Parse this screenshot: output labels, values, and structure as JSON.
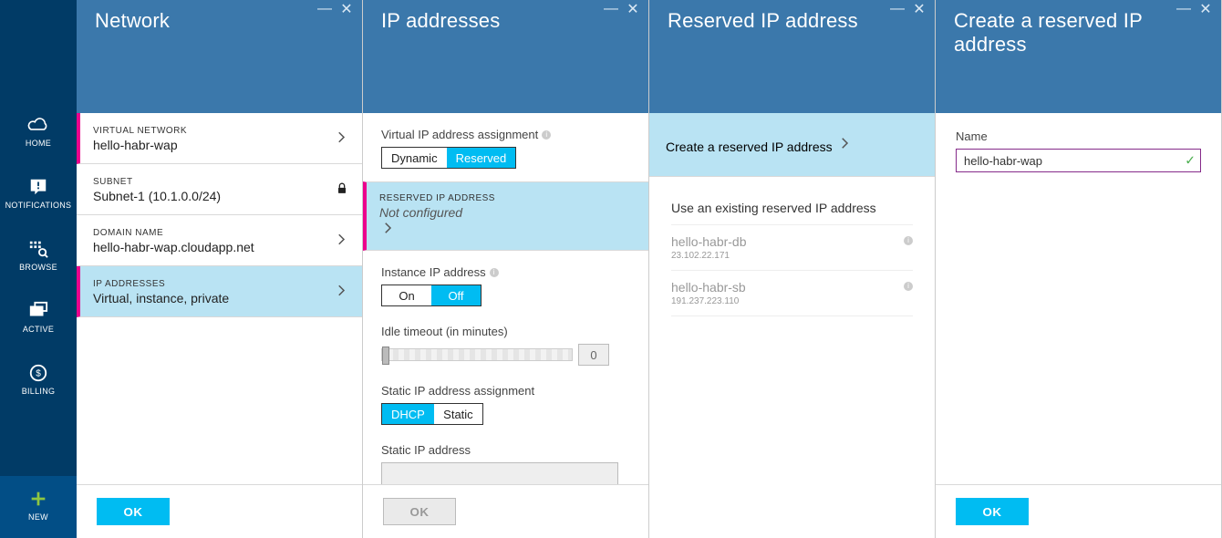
{
  "nav": {
    "home": "HOME",
    "notifications": "NOTIFICATIONS",
    "browse": "BROWSE",
    "active": "ACTIVE",
    "billing": "BILLING",
    "new": "NEW"
  },
  "blade1": {
    "title": "Network",
    "ok": "OK",
    "rows": {
      "vnet": {
        "label": "VIRTUAL NETWORK",
        "value": "hello-habr-wap"
      },
      "subnet": {
        "label": "SUBNET",
        "value": "Subnet-1 (10.1.0.0/24)"
      },
      "domain": {
        "label": "DOMAIN NAME",
        "value": "hello-habr-wap.cloudapp.net"
      },
      "ipaddr": {
        "label": "IP ADDRESSES",
        "value": "Virtual, instance, private"
      }
    }
  },
  "blade2": {
    "title": "IP addresses",
    "vip_label": "Virtual IP address assignment",
    "vip_dynamic": "Dynamic",
    "vip_reserved": "Reserved",
    "reserved": {
      "label": "RESERVED IP ADDRESS",
      "value": "Not configured"
    },
    "instance_label": "Instance IP address",
    "on": "On",
    "off": "Off",
    "idle_label": "Idle timeout (in minutes)",
    "idle_value": "0",
    "static_assign_label": "Static IP address assignment",
    "dhcp": "DHCP",
    "static": "Static",
    "static_ip_label": "Static IP address",
    "ok": "OK"
  },
  "blade3": {
    "title": "Reserved IP address",
    "create": "Create a reserved IP address",
    "existing_header": "Use an existing reserved IP address",
    "items": [
      {
        "name": "hello-habr-db",
        "ip": "23.102.22.171"
      },
      {
        "name": "hello-habr-sb",
        "ip": "191.237.223.110"
      }
    ]
  },
  "blade4": {
    "title": "Create a reserved IP address",
    "name_label": "Name",
    "name_value": "hello-habr-wap",
    "ok": "OK"
  }
}
